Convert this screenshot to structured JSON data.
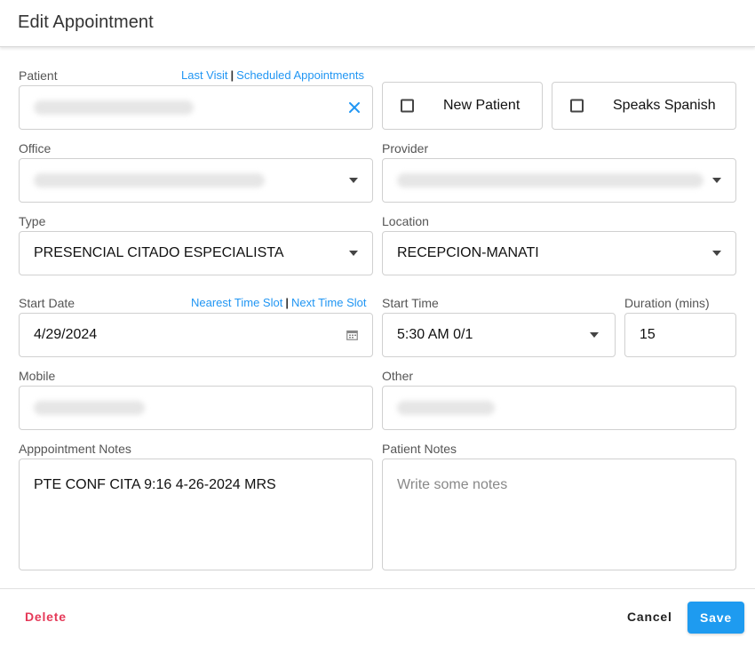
{
  "dialog": {
    "title": "Edit Appointment"
  },
  "patient": {
    "label": "Patient",
    "link_last_visit": "Last Visit",
    "link_separator": "|",
    "link_scheduled": "Scheduled Appointments"
  },
  "new_patient": {
    "label": "New Patient",
    "checked": false
  },
  "speaks_spanish": {
    "label": "Speaks Spanish",
    "checked": false
  },
  "office": {
    "label": "Office"
  },
  "provider": {
    "label": "Provider"
  },
  "type": {
    "label": "Type",
    "value": "PRESENCIAL CITADO ESPECIALISTA"
  },
  "location": {
    "label": "Location",
    "value": "RECEPCION-MANATI"
  },
  "start_date": {
    "label": "Start Date",
    "value": "4/29/2024",
    "link_nearest": "Nearest Time Slot",
    "link_separator": "|",
    "link_next": "Next Time Slot"
  },
  "start_time": {
    "label": "Start Time",
    "value": "5:30 AM 0/1"
  },
  "duration": {
    "label": "Duration (mins)",
    "value": "15"
  },
  "mobile": {
    "label": "Mobile"
  },
  "other": {
    "label": "Other"
  },
  "appointment_notes": {
    "label": "Apppointment Notes",
    "value": "PTE CONF CITA 9:16 4-26-2024 MRS"
  },
  "patient_notes": {
    "label": "Patient Notes",
    "placeholder": "Write some notes"
  },
  "footer": {
    "delete_label": "Delete",
    "cancel_label": "Cancel",
    "save_label": "Save"
  },
  "colors": {
    "accent": "#2196f3",
    "save_button": "#1e9bf0",
    "delete": "#e53958"
  },
  "icons": {
    "clear": "close-icon",
    "dropdown": "chevron-down-icon",
    "calendar": "calendar-icon"
  }
}
